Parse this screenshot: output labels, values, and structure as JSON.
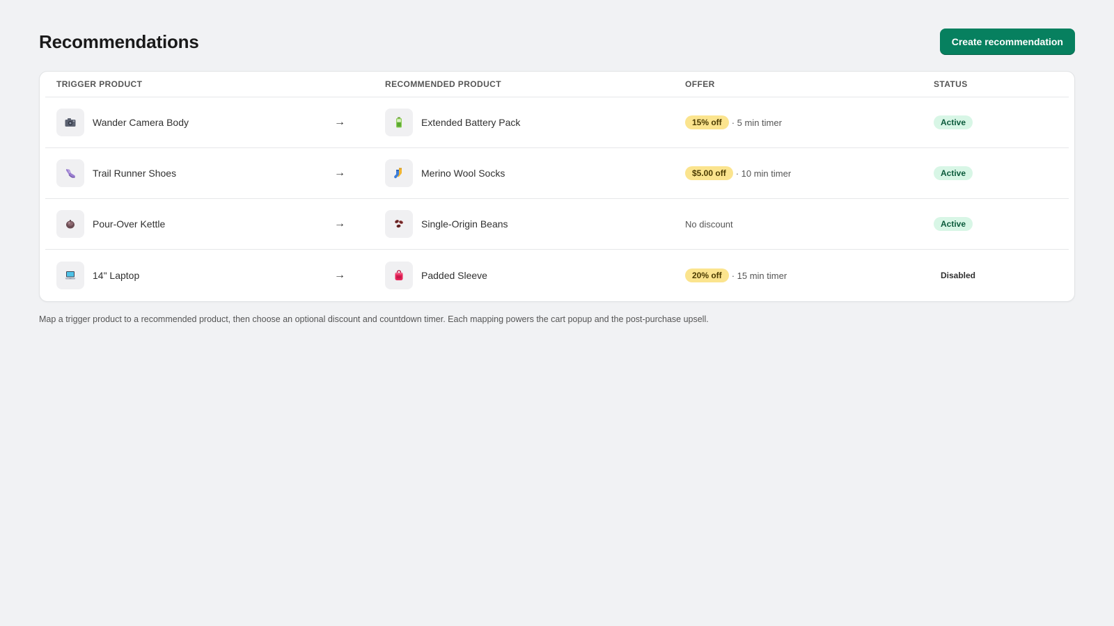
{
  "header": {
    "title": "Recommendations",
    "create_label": "Create recommendation"
  },
  "table": {
    "columns": {
      "trigger": "TRIGGER PRODUCT",
      "recommended": "RECOMMENDED PRODUCT",
      "offer": "OFFER",
      "status": "STATUS"
    },
    "arrow_glyph": "→",
    "rows": [
      {
        "trigger": {
          "name": "Wander Camera Body",
          "icon": "camera-icon"
        },
        "recommended": {
          "name": "Extended Battery Pack",
          "icon": "battery-icon"
        },
        "offer": {
          "discount": "15% off",
          "timer": "· 5 min timer",
          "none": ""
        },
        "status": "Active"
      },
      {
        "trigger": {
          "name": "Trail Runner Shoes",
          "icon": "shoe-icon"
        },
        "recommended": {
          "name": "Merino Wool Socks",
          "icon": "socks-icon"
        },
        "offer": {
          "discount": "$5.00 off",
          "timer": "· 10 min timer",
          "none": ""
        },
        "status": "Active"
      },
      {
        "trigger": {
          "name": "Pour-Over Kettle",
          "icon": "kettle-icon"
        },
        "recommended": {
          "name": "Single-Origin Beans",
          "icon": "coffee-beans-icon"
        },
        "offer": {
          "discount": "",
          "timer": "",
          "none": "No discount"
        },
        "status": "Active"
      },
      {
        "trigger": {
          "name": "14\" Laptop",
          "icon": "laptop-icon"
        },
        "recommended": {
          "name": "Padded Sleeve",
          "icon": "sleeve-bag-icon"
        },
        "offer": {
          "discount": "20% off",
          "timer": "· 15 min timer",
          "none": ""
        },
        "status": "Disabled"
      }
    ]
  },
  "footer": {
    "help_text": "Map a trigger product to a recommended product, then choose an optional discount and countdown timer. Each mapping powers the cart popup and the post-purchase upsell."
  },
  "colors": {
    "primary": "#07805f",
    "active_bg": "#d8f6e6",
    "offer_bg": "#fbe48e"
  }
}
